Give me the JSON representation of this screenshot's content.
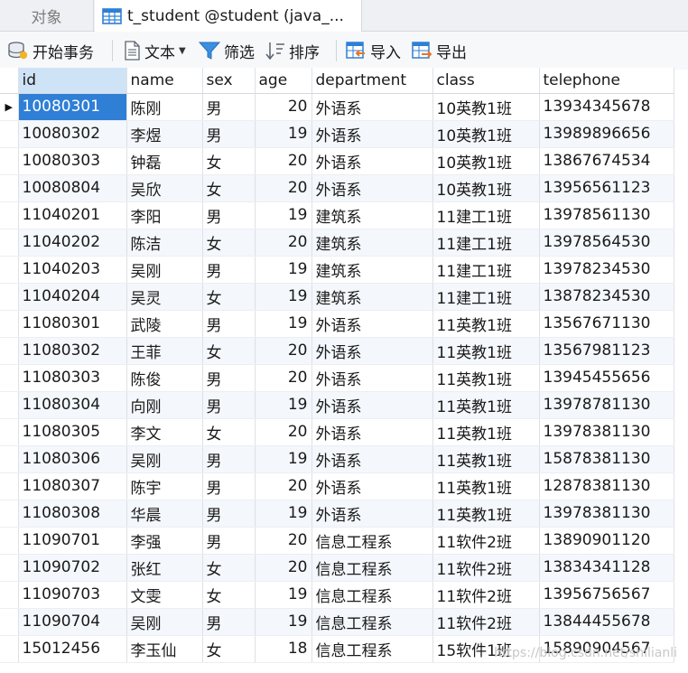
{
  "tabs": [
    {
      "label": "对象"
    },
    {
      "label": "t_student @student (java_..."
    }
  ],
  "toolbar": {
    "begin_transaction": "开始事务",
    "text": "文本",
    "filter": "筛选",
    "sort": "排序",
    "import": "导入",
    "export": "导出"
  },
  "table": {
    "columns": [
      "id",
      "name",
      "sex",
      "age",
      "department",
      "class",
      "telephone"
    ],
    "rows": [
      [
        "10080301",
        "陈刚",
        "男",
        "20",
        "外语系",
        "10英教1班",
        "13934345678"
      ],
      [
        "10080302",
        "李煜",
        "男",
        "19",
        "外语系",
        "10英教1班",
        "13989896656"
      ],
      [
        "10080303",
        "钟磊",
        "女",
        "20",
        "外语系",
        "10英教1班",
        "13867674534"
      ],
      [
        "10080804",
        "吴欣",
        "女",
        "20",
        "外语系",
        "10英教1班",
        "13956561123"
      ],
      [
        "11040201",
        "李阳",
        "男",
        "19",
        "建筑系",
        "11建工1班",
        "13978561130"
      ],
      [
        "11040202",
        "陈洁",
        "女",
        "20",
        "建筑系",
        "11建工1班",
        "13978564530"
      ],
      [
        "11040203",
        "吴刚",
        "男",
        "19",
        "建筑系",
        "11建工1班",
        "13978234530"
      ],
      [
        "11040204",
        "吴灵",
        "女",
        "19",
        "建筑系",
        "11建工1班",
        "13878234530"
      ],
      [
        "11080301",
        "武陵",
        "男",
        "19",
        "外语系",
        "11英教1班",
        "13567671130"
      ],
      [
        "11080302",
        "王菲",
        "女",
        "20",
        "外语系",
        "11英教1班",
        "13567981123"
      ],
      [
        "11080303",
        "陈俊",
        "男",
        "20",
        "外语系",
        "11英教1班",
        "13945455656"
      ],
      [
        "11080304",
        "向刚",
        "男",
        "19",
        "外语系",
        "11英教1班",
        "13978781130"
      ],
      [
        "11080305",
        "李文",
        "女",
        "20",
        "外语系",
        "11英教1班",
        "13978381130"
      ],
      [
        "11080306",
        "吴刚",
        "男",
        "19",
        "外语系",
        "11英教1班",
        "15878381130"
      ],
      [
        "11080307",
        "陈宇",
        "男",
        "20",
        "外语系",
        "11英教1班",
        "12878381130"
      ],
      [
        "11080308",
        "华晨",
        "男",
        "19",
        "外语系",
        "11英教1班",
        "13978381130"
      ],
      [
        "11090701",
        "李强",
        "男",
        "20",
        "信息工程系",
        "11软件2班",
        "13890901120"
      ],
      [
        "11090702",
        "张红",
        "女",
        "20",
        "信息工程系",
        "11软件2班",
        "13834341128"
      ],
      [
        "11090703",
        "文雯",
        "女",
        "19",
        "信息工程系",
        "11软件2班",
        "13956756567"
      ],
      [
        "11090704",
        "吴刚",
        "男",
        "19",
        "信息工程系",
        "11软件2班",
        "13844455678"
      ],
      [
        "15012456",
        "李玉仙",
        "女",
        "18",
        "信息工程系",
        "15软件1班",
        "15890904567"
      ]
    ],
    "selected_row": 0,
    "selected_column": 0
  },
  "watermark": "https://blog.csdn.net/shilianli"
}
